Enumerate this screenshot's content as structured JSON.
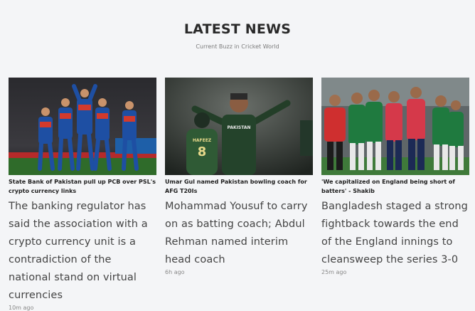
{
  "section": {
    "title": "LATEST NEWS",
    "subtitle": "Current Buzz in Cricket World"
  },
  "articles": [
    {
      "headline": "State Bank of Pakistan pull up PCB over PSL's crypto currency links",
      "summary": "The banking regulator has said the association with a crypto currency unit is a contradiction of the national stand on virtual currencies",
      "time": "10m ago",
      "image_icon": "team-celebration-photo"
    },
    {
      "headline": "Umar Gul named Pakistan bowling coach for AFG T20Is",
      "summary": "Mohammad Yousuf to carry on as batting coach; Abdul Rehman named interim head coach",
      "time": "6h ago",
      "image_icon": "bowler-celebration-photo",
      "jersey_text": "PAKISTAN",
      "player_back_name": "HAFEEZ",
      "player_back_number": "8"
    },
    {
      "headline": "'We capitalized on England being short of batters' - Shakib",
      "summary": "Bangladesh staged a strong fightback towards the end of the England innings to cleansweep the series 3-0",
      "time": "25m ago",
      "image_icon": "teams-on-field-photo"
    }
  ]
}
